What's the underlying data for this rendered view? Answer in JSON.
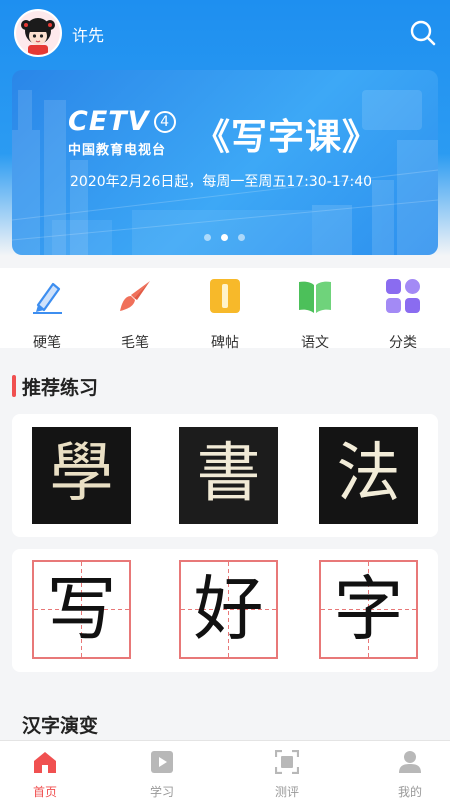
{
  "user": {
    "name": "许先"
  },
  "banner": {
    "logo_text": "CETV",
    "logo_number": "4",
    "logo_subtitle": "中国教育电视台",
    "title": "《写字课》",
    "subtitle": "2020年2月26日起，每周一至周五17:30-17:40",
    "pages": 3,
    "active_page": 2
  },
  "categories": [
    {
      "label": "硬笔",
      "icon": "pen-icon",
      "color": "#3d8ef0"
    },
    {
      "label": "毛笔",
      "icon": "brush-icon",
      "color": "#f0705a"
    },
    {
      "label": "碑帖",
      "icon": "tablet-icon",
      "color": "#f7b92a"
    },
    {
      "label": "语文",
      "icon": "book-icon",
      "color": "#4cc05a"
    },
    {
      "label": "分类",
      "icon": "grid-icon",
      "color": "#8a6cf0"
    }
  ],
  "recommended": {
    "title": "推荐练习",
    "rubbings": [
      "學",
      "書",
      "法"
    ],
    "practice": [
      "写",
      "好",
      "字"
    ]
  },
  "evolution": {
    "title": "汉字演变"
  },
  "tabs": [
    {
      "label": "首页",
      "icon": "home-icon",
      "active": true
    },
    {
      "label": "学习",
      "icon": "play-icon",
      "active": false
    },
    {
      "label": "测评",
      "icon": "scan-icon",
      "active": false
    },
    {
      "label": "我的",
      "icon": "user-icon",
      "active": false
    }
  ],
  "colors": {
    "primary": "#1e8ff0",
    "accent": "#f05050",
    "grid": "#e87878"
  }
}
